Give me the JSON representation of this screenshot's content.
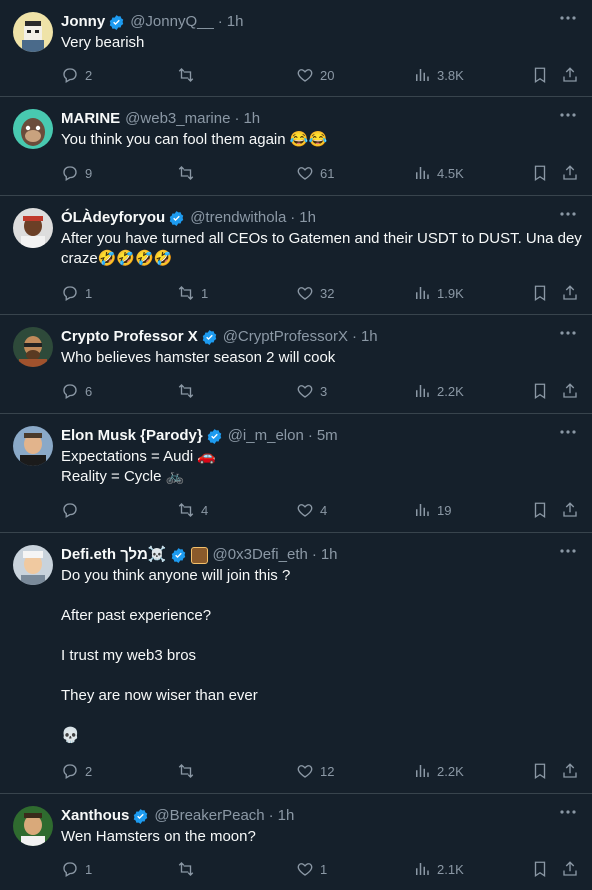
{
  "tweets": [
    {
      "name": "Jonny",
      "handle": "@JonnyQ__",
      "time": "1h",
      "text": "Very bearish",
      "replies": "2",
      "retweets": "",
      "likes": "20",
      "views": "3.8K",
      "verified": true
    },
    {
      "name": "MARINE",
      "handle": "@web3_marine",
      "time": "1h",
      "text": "You think you can fool them again 😂😂",
      "replies": "9",
      "retweets": "",
      "likes": "61",
      "views": "4.5K",
      "verified": false
    },
    {
      "name": "ÓLÀdeyforyou",
      "handle": "@trendwithola",
      "time": "1h",
      "text": "After you have turned all CEOs to Gatemen and their USDT to DUST. Una dey\ncraze🤣🤣🤣🤣",
      "replies": "1",
      "retweets": "1",
      "likes": "32",
      "views": "1.9K",
      "verified": true
    },
    {
      "name": "Crypto Professor X",
      "handle": "@CryptProfessorX",
      "time": "1h",
      "text": "Who believes hamster season 2 will cook",
      "replies": "6",
      "retweets": "",
      "likes": "3",
      "views": "2.2K",
      "verified": true
    },
    {
      "name": "Elon Musk {Parody}",
      "handle": "@i_m_elon",
      "time": "5m",
      "text": "Expectations = Audi 🚗\nReality = Cycle 🚲",
      "replies": "",
      "retweets": "4",
      "likes": "4",
      "views": "19",
      "verified": true
    },
    {
      "name": "Defi.eth מלך☠️",
      "handle": "@0x3Defi_eth",
      "time": "1h",
      "text": "Do you think anyone will join this ?\n\nAfter past experience?\n\nI trust my web3 bros\n\nThey are now wiser than ever\n\n💀",
      "replies": "2",
      "retweets": "",
      "likes": "12",
      "views": "2.2K",
      "verified": true
    },
    {
      "name": "Xanthous",
      "handle": "@BreakerPeach",
      "time": "1h",
      "text": "Wen Hamsters on the moon?",
      "replies": "1",
      "retweets": "",
      "likes": "1",
      "views": "2.1K",
      "verified": true
    }
  ],
  "colors": {
    "background": "#15202b",
    "accent": "#1d9bf0",
    "muted": "#8b98a5",
    "divider": "#38444d"
  },
  "icons": [
    "reply-icon",
    "retweet-icon",
    "like-icon",
    "views-icon",
    "bookmark-icon",
    "share-icon",
    "more-icon",
    "verified-icon"
  ]
}
